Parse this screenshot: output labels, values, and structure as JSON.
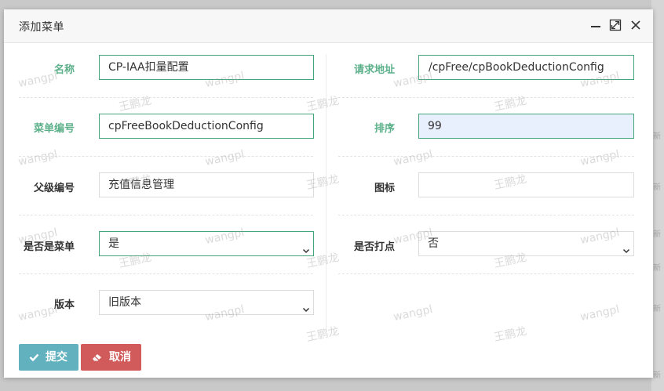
{
  "dialog": {
    "title": "添加菜单"
  },
  "form": {
    "name": {
      "label": "名称",
      "value": "CP-IAA扣量配置"
    },
    "url": {
      "label": "请求地址",
      "value": "/cpFree/cpBookDeductionConfig"
    },
    "menu_code": {
      "label": "菜单编号",
      "value": "cpFreeBookDeductionConfig"
    },
    "sort": {
      "label": "排序",
      "value": "99"
    },
    "parent_code": {
      "label": "父级编号",
      "value": "充值信息管理"
    },
    "icon": {
      "label": "图标",
      "value": ""
    },
    "is_menu": {
      "label": "是否是菜单",
      "value": "是"
    },
    "is_track": {
      "label": "是否打点",
      "value": "否"
    },
    "version": {
      "label": "版本",
      "value": "旧版本"
    }
  },
  "buttons": {
    "submit": "提交",
    "cancel": "取消"
  },
  "watermark": {
    "latin": "wangpl",
    "cjk": "王鹏龙"
  },
  "background_strip": [
    "新",
    "新",
    "新",
    "新",
    "新",
    "新"
  ],
  "colors": {
    "valid_border": "#43a57a",
    "label_green": "#5cb08a",
    "submit_bg": "#62b1bf",
    "cancel_bg": "#d15b5b",
    "autofill_bg": "#e8effd"
  }
}
